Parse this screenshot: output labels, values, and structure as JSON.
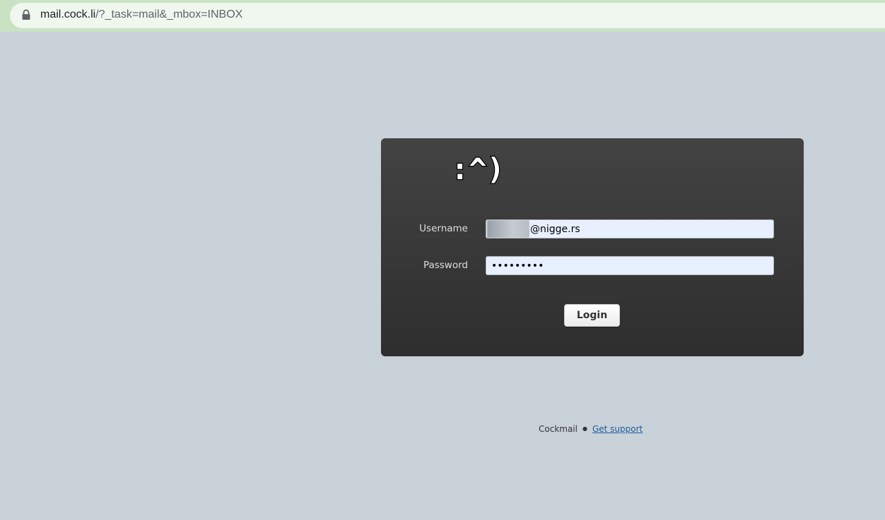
{
  "browser": {
    "url_host": "mail.cock.li",
    "url_path": "/?_task=mail&_mbox=INBOX",
    "icons": {
      "lock": "lock-icon"
    }
  },
  "login": {
    "logo_text": ":^)",
    "username_label": "Username",
    "username_value": "@nigge.rs",
    "password_label": "Password",
    "password_value": "•••••••••",
    "login_button": "Login"
  },
  "footer": {
    "brand": "Cockmail",
    "separator": "●",
    "support_link": "Get support"
  },
  "colors": {
    "page_bg": "#c9d1d9",
    "box_bg_top": "#434343",
    "box_bg_bottom": "#2e2e2e",
    "field_bg": "#e8f0fe",
    "link": "#1c5d9b"
  }
}
